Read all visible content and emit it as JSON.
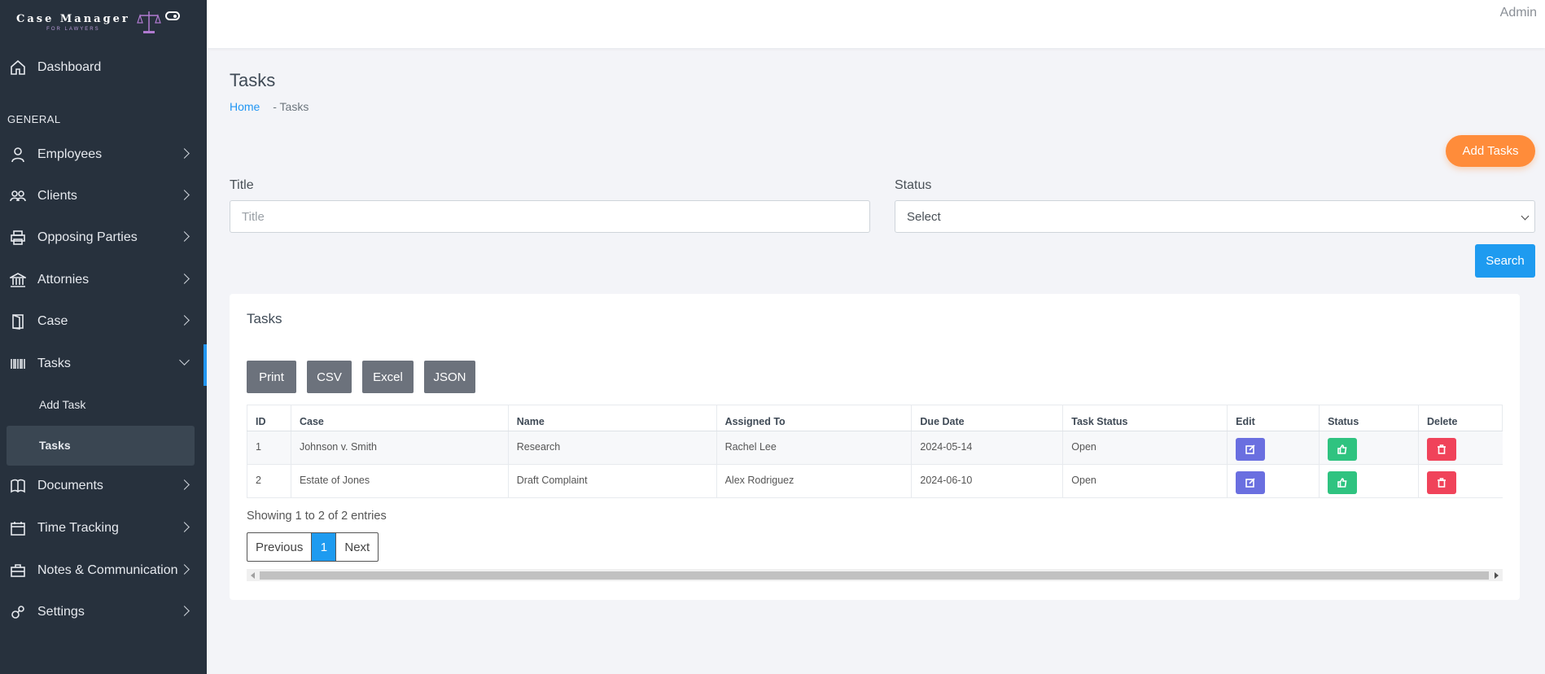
{
  "brand": {
    "title": "Case Manager",
    "subtitle": "FOR LAWYERS"
  },
  "topbar": {
    "user": "Admin"
  },
  "sidebar": {
    "section_general": "GENERAL",
    "items": [
      {
        "label": "Dashboard",
        "icon": "home-icon"
      },
      {
        "label": "Employees",
        "icon": "user-icon"
      },
      {
        "label": "Clients",
        "icon": "users-icon"
      },
      {
        "label": "Opposing Parties",
        "icon": "printer-icon"
      },
      {
        "label": "Attornies",
        "icon": "bank-icon"
      },
      {
        "label": "Case",
        "icon": "door-icon"
      },
      {
        "label": "Tasks",
        "icon": "barcode-icon"
      },
      {
        "label": "Documents",
        "icon": "book-icon"
      },
      {
        "label": "Time Tracking",
        "icon": "calendar-icon"
      },
      {
        "label": "Notes & Communication",
        "icon": "briefcase-icon"
      },
      {
        "label": "Settings",
        "icon": "gears-icon"
      }
    ],
    "tasks_sub": [
      "Add Task",
      "Tasks"
    ],
    "accent_color": "#2196f3"
  },
  "page": {
    "title": "Tasks",
    "breadcrumb": {
      "home": "Home",
      "current": "- Tasks"
    },
    "add_button": "Add Tasks"
  },
  "filters": {
    "title_label": "Title",
    "title_placeholder": "Title",
    "status_label": "Status",
    "status_selected": "Select",
    "search_button": "Search"
  },
  "card": {
    "title": "Tasks",
    "export_buttons": [
      "Print",
      "CSV",
      "Excel",
      "JSON"
    ],
    "columns": [
      "ID",
      "Case",
      "Name",
      "Assigned To",
      "Due Date",
      "Task Status",
      "Edit",
      "Status",
      "Delete"
    ],
    "rows": [
      {
        "id": "1",
        "case": "Johnson v. Smith",
        "name": "Research",
        "assigned": "Rachel Lee",
        "due": "2024-05-14",
        "status": "Open"
      },
      {
        "id": "2",
        "case": "Estate of Jones",
        "name": "Draft Complaint",
        "assigned": "Alex Rodriguez",
        "due": "2024-06-10",
        "status": "Open"
      }
    ],
    "showing": "Showing 1 to 2 of 2 entries",
    "pager": {
      "prev": "Previous",
      "current": "1",
      "next": "Next"
    }
  },
  "colors": {
    "add": "#ff8c3a",
    "search": "#1e9bf0",
    "edit": "#6a6fe0",
    "approve": "#2fc380",
    "delete": "#f0435a"
  }
}
